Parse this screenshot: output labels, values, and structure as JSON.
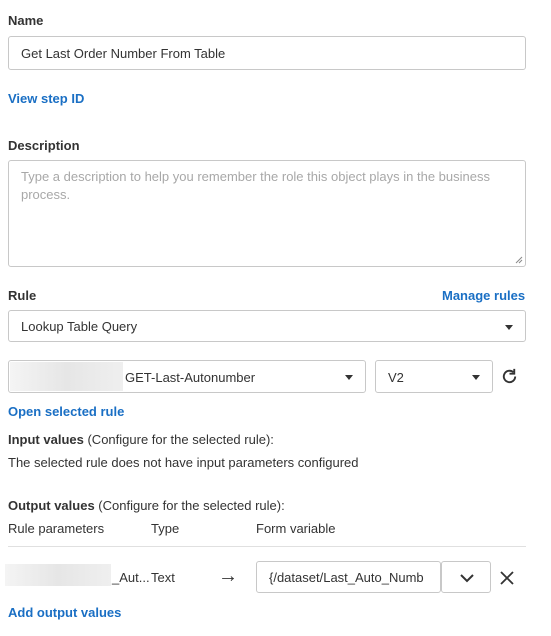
{
  "name_section": {
    "label": "Name",
    "value": "Get Last Order Number From Table",
    "view_step_id": "View step ID"
  },
  "description_section": {
    "label": "Description",
    "placeholder": "Type a description to help you remember the role this object plays in the business process."
  },
  "rule_section": {
    "label": "Rule",
    "manage_rules": "Manage rules",
    "rule_type": "Lookup Table Query",
    "rule_name": "GET-Last-Autonumber",
    "version": "V2",
    "open_selected_rule": "Open selected rule"
  },
  "input_values": {
    "heading": "Input values",
    "heading_suffix": " (Configure for the selected rule):",
    "message": "The selected rule does not have input parameters configured"
  },
  "output_values": {
    "heading": "Output values",
    "heading_suffix": " (Configure for the selected rule):",
    "columns": [
      "Rule parameters",
      "Type",
      "Form variable"
    ],
    "rows": [
      {
        "parameter": "_Aut...",
        "type": "Text",
        "arrow": "→",
        "form_variable": "{/dataset/Last_Auto_Numb"
      }
    ],
    "add_link": "Add output values"
  }
}
